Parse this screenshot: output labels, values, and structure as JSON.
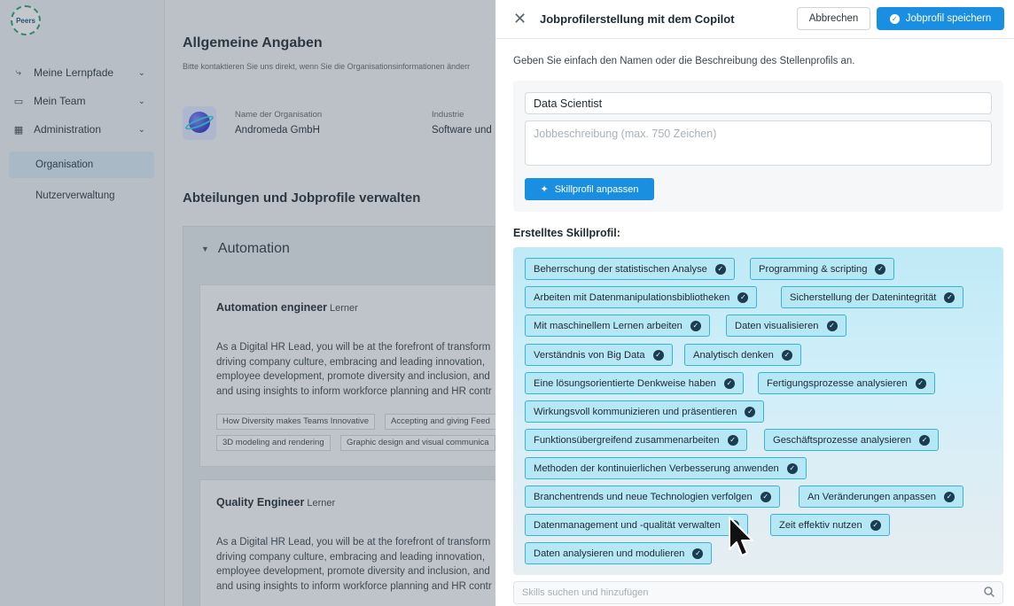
{
  "app": {
    "logo_text": "Peers",
    "nav": [
      {
        "label": "Meine Lernpfade",
        "icon": "path-icon"
      },
      {
        "label": "Mein Team",
        "icon": "team-icon"
      },
      {
        "label": "Administration",
        "icon": "admin-icon"
      }
    ],
    "subnav": [
      {
        "label": "Organisation",
        "active": true
      },
      {
        "label": "Nutzerverwaltung",
        "active": false
      }
    ],
    "main": {
      "title": "Allgemeine Angaben",
      "subtitle": "Bitte kontaktieren Sie uns direkt, wenn Sie die Organisationsinformationen änderr",
      "org_name_label": "Name der Organisation",
      "org_name": "Andromeda GmbH",
      "industry_label": "Industrie",
      "industry": "Software und",
      "section_title": "Abteilungen und Jobprofile verwalten",
      "department": "Automation",
      "jobs": [
        {
          "title": "Automation engineer",
          "role": "Lerner",
          "desc": [
            "As a Digital HR Lead, you will be at the forefront of transform",
            "driving company culture, embracing and leading innovation,",
            "employee development, promote diversity and inclusion, and",
            "and using insights to inform workforce planning and HR contr"
          ],
          "tags": [
            [
              "How Diversity makes Teams Innovative",
              "Accepting and giving Feed"
            ],
            [
              "3D modeling and rendering",
              "Graphic design and visual communica"
            ]
          ]
        },
        {
          "title": "Quality Engineer",
          "role": "Lerner",
          "desc": [
            "As a Digital HR Lead, you will be at the forefront of transform",
            "driving company culture, embracing and leading innovation,",
            "employee development, promote diversity and inclusion, and",
            "and using insights to inform workforce planning and HR contr"
          ]
        }
      ]
    }
  },
  "panel": {
    "title": "Jobprofilerstellung mit dem Copilot",
    "cancel_label": "Abbrechen",
    "save_label": "Jobprofil speichern",
    "instruction": "Geben Sie einfach den Namen oder die Beschreibung des Stellenprofils an.",
    "job_name_value": "Data Scientist",
    "desc_placeholder": "Jobbeschreibung (max. 750 Zeichen)",
    "adapt_label": "Skillprofil anpassen",
    "result_label": "Erstelltes Skillprofil:",
    "skills": [
      [
        "Beherrschung der statistischen Analyse",
        "Programming & scripting"
      ],
      [
        "Arbeiten mit Datenmanipulationsbibliotheken",
        "Sicherstellung der Datenintegrität"
      ],
      [
        "Mit maschinellem Lernen arbeiten",
        "Daten visualisieren"
      ],
      [
        "Verständnis von Big Data",
        "Analytisch denken"
      ],
      [
        "Eine lösungsorientierte Denkweise haben",
        "Fertigungsprozesse analysieren"
      ],
      [
        "Wirkungsvoll kommunizieren und präsentieren"
      ],
      [
        "Funktionsübergreifend zusammenarbeiten",
        "Geschäftsprozesse analysieren"
      ],
      [
        "Methoden der kontinuierlichen Verbesserung anwenden"
      ],
      [
        "Branchentrends und neue Technologien verfolgen",
        "An Veränderungen anpassen"
      ],
      [
        "Datenmanagement und -qualität verwalten",
        "Zeit effektiv nutzen"
      ],
      [
        "Daten analysieren und modulieren"
      ]
    ],
    "search_placeholder": "Skills suchen und hinzufügen"
  },
  "colors": {
    "accent": "#1a8ee0",
    "chip_bg": "#b5e7f5",
    "chip_border": "#38b3d6",
    "chip_check": "#1a3d52"
  }
}
